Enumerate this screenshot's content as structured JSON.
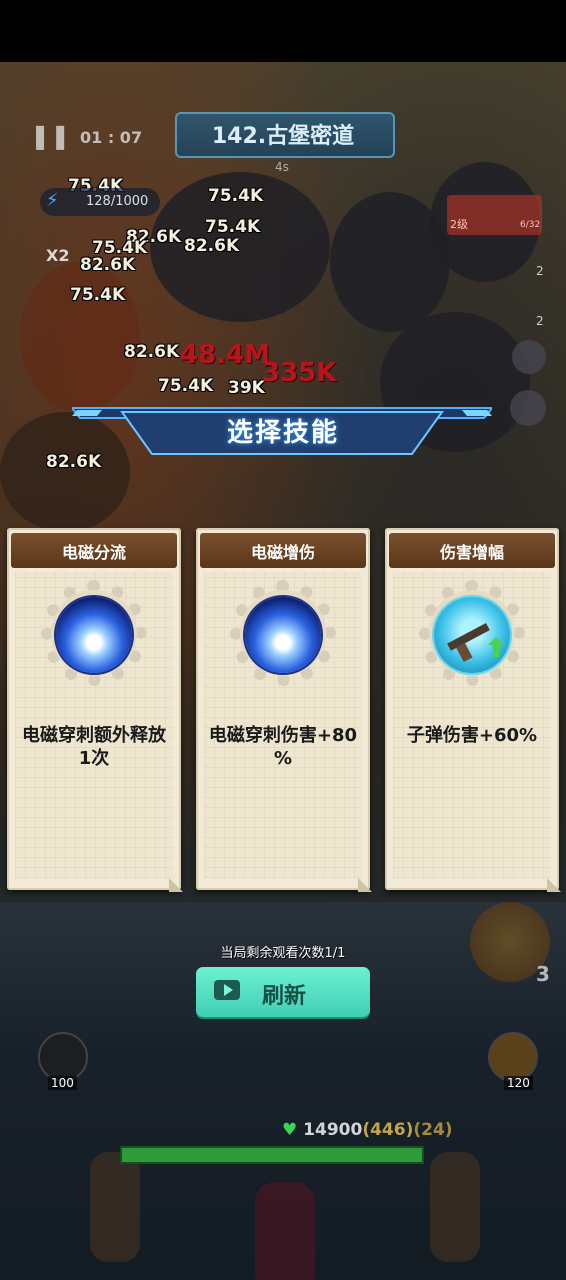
{
  "hud": {
    "level_title": "142.古堡密道",
    "timer": "01 : 07",
    "energy": "128/1000",
    "multiplier": "X2",
    "wave_label": "2级",
    "wave_count": "6/32",
    "countdown": "4s",
    "side_count_top": "2",
    "side_count_bottom": "2",
    "right_number": "3"
  },
  "damage_numbers": [
    "75.4K",
    "75.4K",
    "75.4K",
    "82.6K",
    "82.6K",
    "75.4K",
    "82.6K",
    "75.4K",
    "82.6K",
    "75.4K",
    "39K",
    "48.4M",
    "335K",
    "82.6K"
  ],
  "banner": {
    "title": "选择技能"
  },
  "cards": [
    {
      "name": "电磁分流",
      "desc_line1": "电磁穿刺额外释放",
      "desc_line2": "1次",
      "icon": "electric-burst-icon"
    },
    {
      "name": "电磁增伤",
      "desc_line1": "电磁穿刺伤害+80",
      "desc_line2": "%",
      "icon": "electric-burst-icon"
    },
    {
      "name": "伤害增幅",
      "desc_line1": "子弹伤害+60%",
      "desc_line2": "",
      "icon": "rifle-upgrade-icon"
    }
  ],
  "bottom": {
    "watch_count": "当局剩余观看次数1/1",
    "refresh_label": "刷新",
    "hp_value": "14900",
    "hp_shield": "(446)",
    "hp_extra": "(24)",
    "left_slot_cost": "100",
    "right_slot_cost": "120"
  },
  "colors": {
    "card_header": "#6a4322",
    "refresh_button": "#55e0c4",
    "banner_glow": "#3aa0ff"
  }
}
